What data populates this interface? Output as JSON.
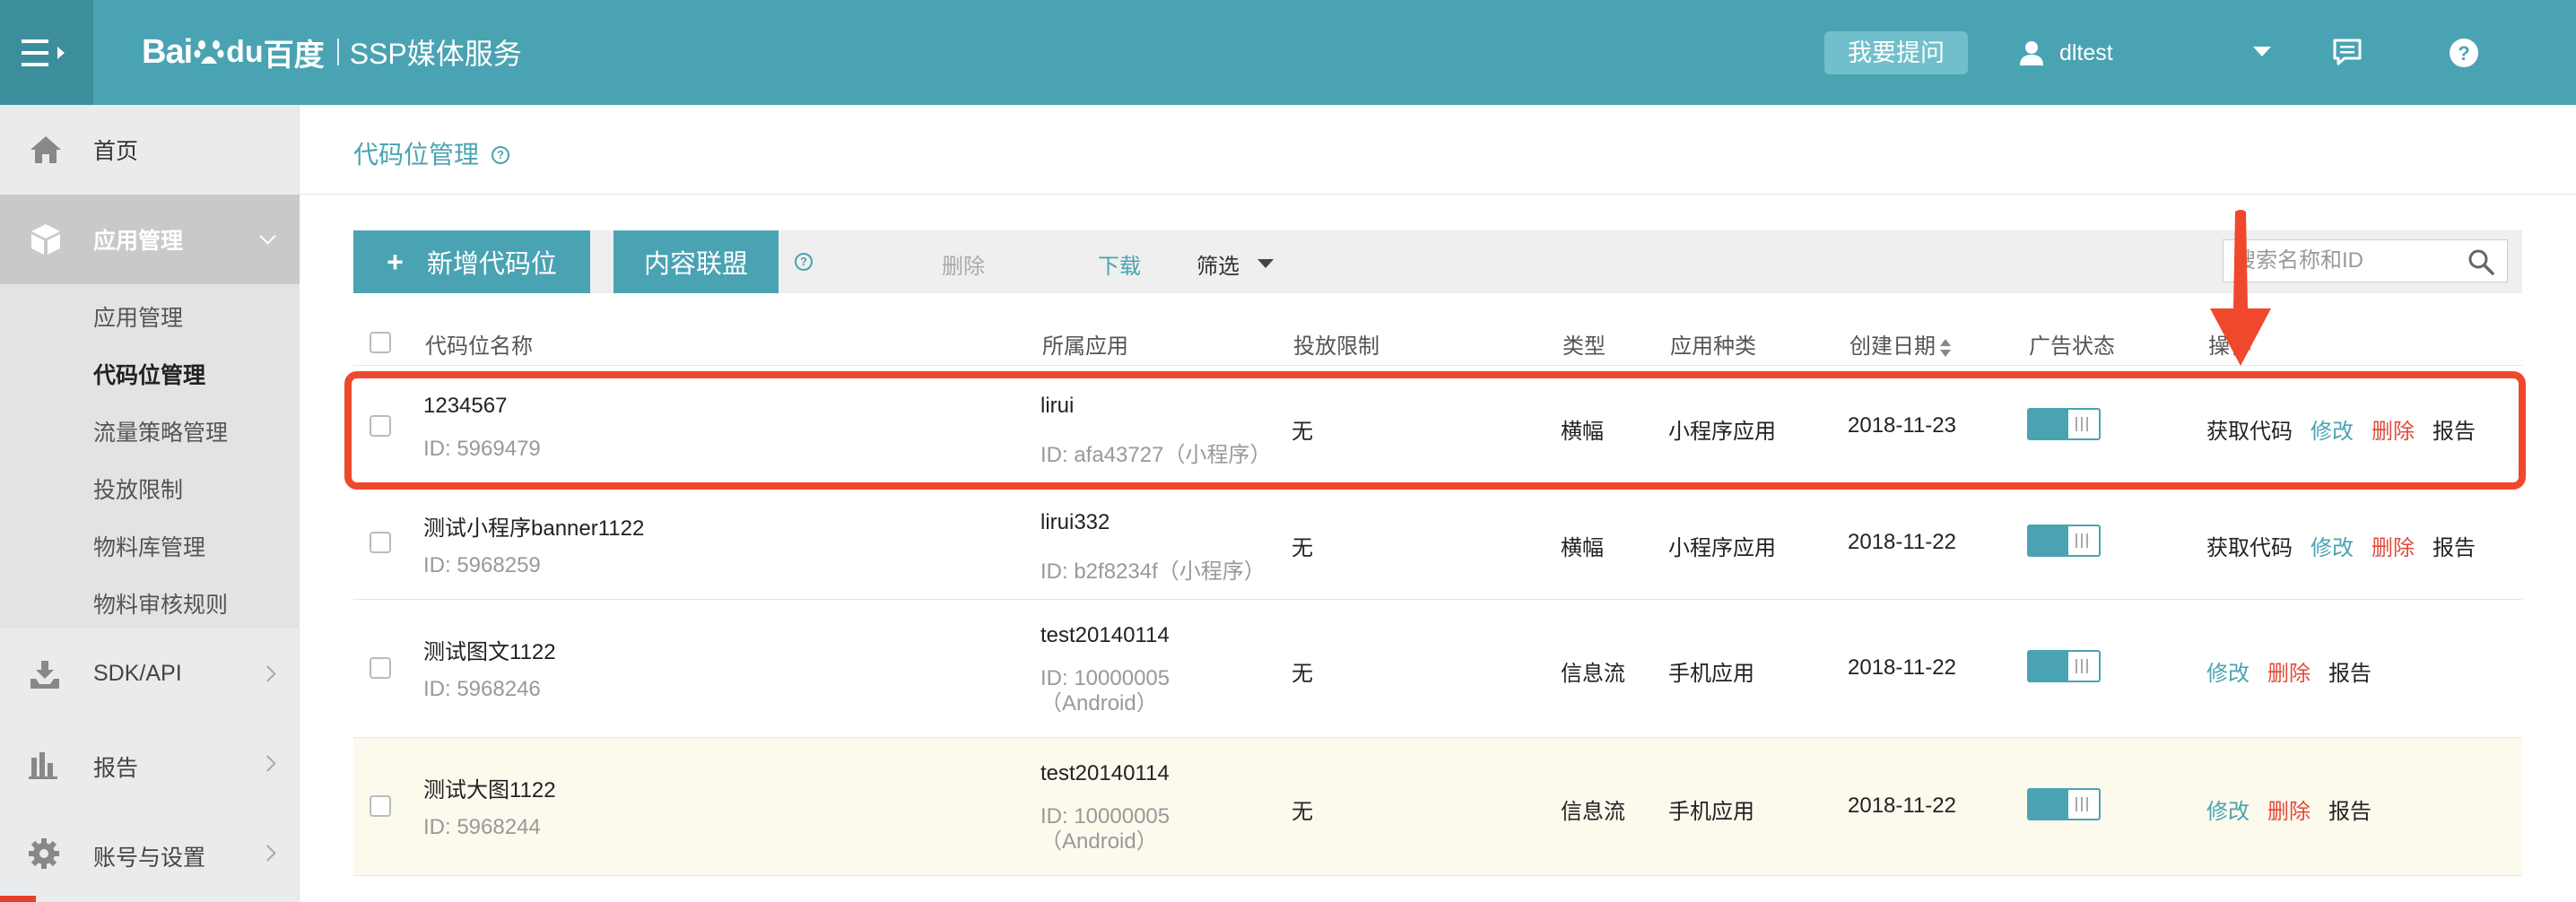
{
  "header": {
    "logo_bai": "Bai",
    "logo_du": "du",
    "logo_baidu_cn": "百度",
    "logo_title": "SSP媒体服务",
    "ask_label": "我要提问",
    "username": "dltest",
    "accent": "#4aa3b2"
  },
  "sidebar": {
    "home": "首页",
    "app_mgmt": "应用管理",
    "sub_items": [
      "应用管理",
      "代码位管理",
      "流量策略管理",
      "投放限制",
      "物料库管理",
      "物料审核规则"
    ],
    "sdk": "SDK/API",
    "report": "报告",
    "account": "账号与设置"
  },
  "page": {
    "title": "代码位管理"
  },
  "toolbar": {
    "add_label": "新增代码位",
    "add_plus": "+",
    "union_label": "内容联盟",
    "delete_label": "删除",
    "download_label": "下载",
    "filter_label": "筛选",
    "search_placeholder": "搜索名称和ID"
  },
  "table": {
    "columns": [
      "代码位名称",
      "所属应用",
      "投放限制",
      "类型",
      "应用种类",
      "创建日期",
      "广告状态",
      "操作"
    ],
    "rows": [
      {
        "name": "1234567",
        "id": "ID: 5969479",
        "app": "lirui",
        "app_id": "ID: afa43727（小程序）",
        "limit": "无",
        "type": "横幅",
        "category": "小程序应用",
        "date": "2018-11-23",
        "status": "on",
        "ops": [
          "获取代码",
          "修改",
          "删除",
          "报告"
        ]
      },
      {
        "name": "测试小程序banner1122",
        "id": "ID: 5968259",
        "app": "lirui332",
        "app_id": "ID: b2f8234f（小程序）",
        "limit": "无",
        "type": "横幅",
        "category": "小程序应用",
        "date": "2018-11-22",
        "status": "on",
        "ops": [
          "获取代码",
          "修改",
          "删除",
          "报告"
        ]
      },
      {
        "name": "测试图文1122",
        "id": "ID: 5968246",
        "app": "test20140114",
        "app_id": "ID: 10000005（Android）",
        "limit": "无",
        "type": "信息流",
        "category": "手机应用",
        "date": "2018-11-22",
        "status": "on",
        "ops": [
          "修改",
          "删除",
          "报告"
        ]
      },
      {
        "name": "测试大图1122",
        "id": "ID: 5968244",
        "app": "test20140114",
        "app_id": "ID: 10000005（Android）",
        "limit": "无",
        "type": "信息流",
        "category": "手机应用",
        "date": "2018-11-22",
        "status": "on",
        "ops": [
          "修改",
          "删除",
          "报告"
        ]
      }
    ]
  },
  "annotation_color": "#f0482c"
}
